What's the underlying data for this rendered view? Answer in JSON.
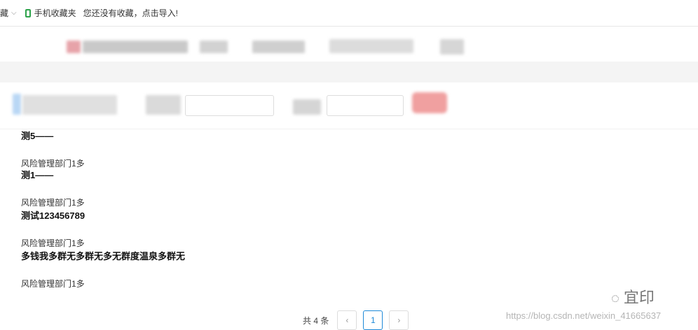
{
  "bookmarks_bar": {
    "fragment": "藏",
    "mobile_bookmarks": "手机收藏夹",
    "import_hint": "您还没有收藏，点击导入!"
  },
  "list": {
    "items": [
      {
        "title": "测5——",
        "dept": "风险管理部门1多"
      },
      {
        "title": "测1——",
        "dept": "风险管理部门1多"
      },
      {
        "title": "测试123456789",
        "dept": "风险管理部门1多"
      },
      {
        "title": "多钱我多群无多群无多无群度温泉多群无",
        "dept": "风险管理部门1多"
      }
    ]
  },
  "pagination": {
    "total": "共 4 条",
    "prev": "‹",
    "current": "1",
    "next": "›"
  },
  "watermark": {
    "logo_text": "宜印",
    "url": "https://blog.csdn.net/weixin_41665637"
  },
  "colors": {
    "accent": "#1e8ad8",
    "bookmark_icon": "#2ca24a"
  }
}
